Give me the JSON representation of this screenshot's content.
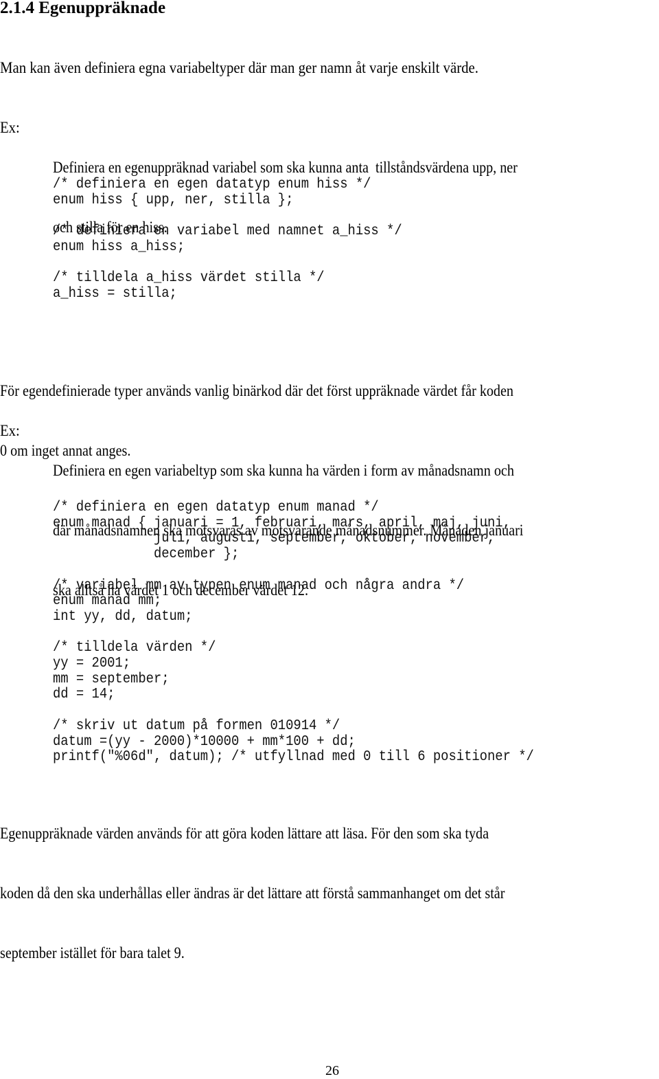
{
  "document": {
    "section_heading": "2.1.4 Egenuppräknade",
    "intro_paragraph": "Man kan även definiera egna variabeltyper där man ger namn åt varje enskilt värde.",
    "example_1": {
      "label": "Ex:",
      "lines": [
        "Definiera en egenuppräknad variabel som ska kunna anta  tillståndsvärdena upp, ner",
        "och stilla för en hiss."
      ]
    },
    "code_block_1": {
      "lines": [
        "/* definiera en egen datatyp enum hiss */",
        "enum hiss { upp, ner, stilla };",
        "",
        "/* definiera en variabel med namnet a_hiss */",
        "enum hiss a_hiss;",
        "",
        "/* tilldela a_hiss värdet stilla */",
        "a_hiss = stilla;"
      ]
    },
    "paragraph_2": {
      "lines": [
        "För egendefinierade typer används vanlig binärkod där det först uppräknade värdet får koden",
        "0 om inget annat anges."
      ]
    },
    "example_2": {
      "label": "Ex:",
      "lines": [
        "Definiera en egen variabeltyp som ska kunna ha värden i form av månadsnamn och",
        "där månadsnamnen ska motsvaras av motsvarande månadsnummer. Månaden januari",
        "ska alltså ha värdet 1 och december värdet 12."
      ]
    },
    "code_block_2": {
      "lines": [
        "/* definiera en egen datatyp enum manad */",
        "enum manad { januari = 1, februari, mars, april, maj, juni,",
        "             juli, augusti, september, oktober, november,",
        "             december };",
        "",
        "/* variabel mm av typen enum manad och några andra */",
        "enum manad mm;",
        "int yy, dd, datum;",
        "",
        "/* tilldela värden */",
        "yy = 2001;",
        "mm = september;",
        "dd = 14;",
        "",
        "/* skriv ut datum på formen 010914 */",
        "datum =(yy - 2000)*10000 + mm*100 + dd;",
        "printf(\"%06d\", datum); /* utfyllnad med 0 till 6 positioner */"
      ]
    },
    "paragraph_3": {
      "lines": [
        "Egenuppräknade värden används för att göra koden lättare att läsa. För den som ska tyda",
        "koden då den ska underhållas eller ändras är det lättare att förstå sammanhanget om det står",
        "september istället för bara talet 9."
      ]
    },
    "page_number": "26"
  }
}
